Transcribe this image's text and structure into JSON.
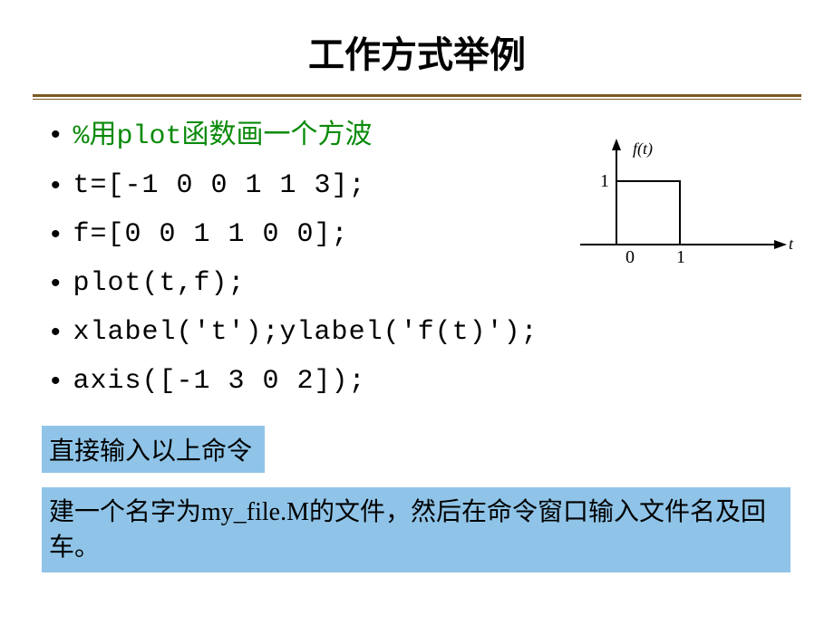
{
  "title": "工作方式举例",
  "lines": [
    {
      "pct": "%",
      "cjk1": "用",
      "mono": "plot",
      "cjk2": "函数画一个方波"
    },
    {
      "code": "t=[-1 0 0 1 1 3];"
    },
    {
      "code": "f=[0 0 1 1 0 0];"
    },
    {
      "code": "plot(t,f);"
    },
    {
      "code": "xlabel('t');ylabel('f(t)');"
    },
    {
      "code": "axis([-1 3 0 2]);"
    }
  ],
  "note1": "直接输入以上命令",
  "note2": "建一个名字为my_file.M的文件，然后在命令窗口输入文件名及回车。",
  "figure": {
    "ylabel_tick": "1",
    "origin": "0",
    "xtick": "1",
    "xlabel": "t",
    "funclabel": "f(t)"
  }
}
